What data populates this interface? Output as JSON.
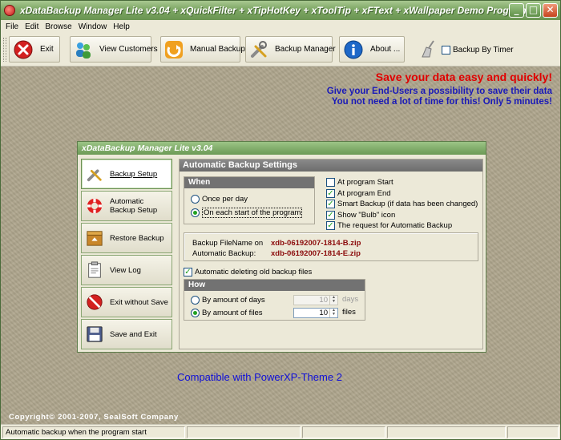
{
  "window": {
    "title": "xDataBackup Manager Lite v3.04 + xQuickFilter + xTipHotKey + xToolTip + xFText + xWallpaper Demo Program",
    "controls": {
      "minimize": "_",
      "maximize": "□",
      "close": "✕"
    }
  },
  "menu": [
    "File",
    "Edit",
    "Browse",
    "Window",
    "Help"
  ],
  "toolbar": {
    "buttons": [
      {
        "label": "Exit",
        "icon": "exit-icon"
      },
      {
        "label": "View Customers",
        "icon": "customers-icon"
      },
      {
        "label": "Manual Backup",
        "icon": "backup-icon"
      },
      {
        "label": "Backup Manager",
        "icon": "tools-icon"
      },
      {
        "label": "About ...",
        "icon": "info-icon"
      }
    ],
    "timer_checkbox": {
      "label": "Backup By Timer",
      "checked": false
    }
  },
  "banner": {
    "headline": "Save your data easy and quickly!",
    "line1": "Give your End-Users a possibility to save their data",
    "line2": "You not need a lot of time for this! Only 5 minutes!"
  },
  "dialog": {
    "title": "xDataBackup Manager Lite v3.04",
    "sidebar": [
      {
        "label": "Backup Setup",
        "icon": "tools-icon"
      },
      {
        "label": "Automatic Backup Setup",
        "icon": "lifebuoy-icon"
      },
      {
        "label": "Restore Backup",
        "icon": "restore-icon"
      },
      {
        "label": "View Log",
        "icon": "log-icon"
      },
      {
        "label": "Exit without Save",
        "icon": "stop-icon"
      },
      {
        "label": "Save and Exit",
        "icon": "floppy-icon"
      }
    ],
    "panel_title": "Automatic Backup Settings",
    "when": {
      "heading": "When",
      "option1": "Once per day",
      "option2": "On each start of the program",
      "selected": "option2"
    },
    "checks": [
      {
        "label": "At program Start",
        "checked": false
      },
      {
        "label": "At program End",
        "checked": true
      },
      {
        "label": "Smart Backup (if data has been changed)",
        "checked": true
      },
      {
        "label": "Show \"Bulb\" icon",
        "checked": true
      },
      {
        "label": "The request for Automatic Backup",
        "checked": true
      }
    ],
    "filename": {
      "label1": "Backup FileName on",
      "value1": "xdb-06192007-1814-B.zip",
      "label2": "Automatic Backup:",
      "value2": "xdb-06192007-1814-E.zip"
    },
    "auto_delete": {
      "label": "Automatic deleting old backup files",
      "checked": true
    },
    "how": {
      "heading": "How",
      "option1": "By amount of days",
      "option1_value": "10",
      "option1_unit": "days",
      "option2": "By amount of files",
      "option2_value": "10",
      "option2_unit": "files",
      "selected": "option2"
    }
  },
  "compat_text": "Compatible with PowerXP-Theme 2",
  "copyright": "Copyright© 2001-2007, SealSoft Company",
  "status": {
    "text": "Automatic backup when the program start"
  },
  "colors": {
    "accent_green": "#7da764",
    "headline_red": "#e00000",
    "text_blue": "#1a1ab8",
    "filename_red": "#8b0b0b"
  }
}
